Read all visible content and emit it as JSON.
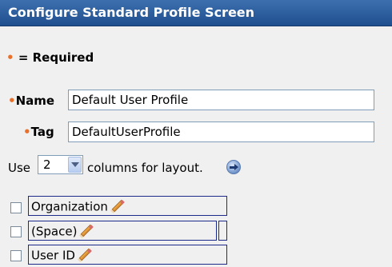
{
  "header": {
    "title": "Configure Standard Profile Screen"
  },
  "legend": {
    "marker": "•",
    "text": " = Required"
  },
  "form": {
    "name": {
      "marker": "•",
      "label": "Name",
      "value": "Default User Profile"
    },
    "tag": {
      "marker": "•",
      "label": "Tag",
      "value": "DefaultUserProfile"
    }
  },
  "layout": {
    "prefix": "Use",
    "columns_value": "2",
    "suffix": "columns for layout."
  },
  "items": [
    {
      "label": "Organization",
      "checked": false
    },
    {
      "label": "(Space)",
      "checked": false
    },
    {
      "label": "User ID",
      "checked": false
    }
  ],
  "colors": {
    "header_bg": "#2b5b9b",
    "required_marker": "#e8702a",
    "item_border": "#1c2b8a"
  },
  "icons": [
    "pencil-icon",
    "go-arrow-icon",
    "chevron-down-icon"
  ]
}
